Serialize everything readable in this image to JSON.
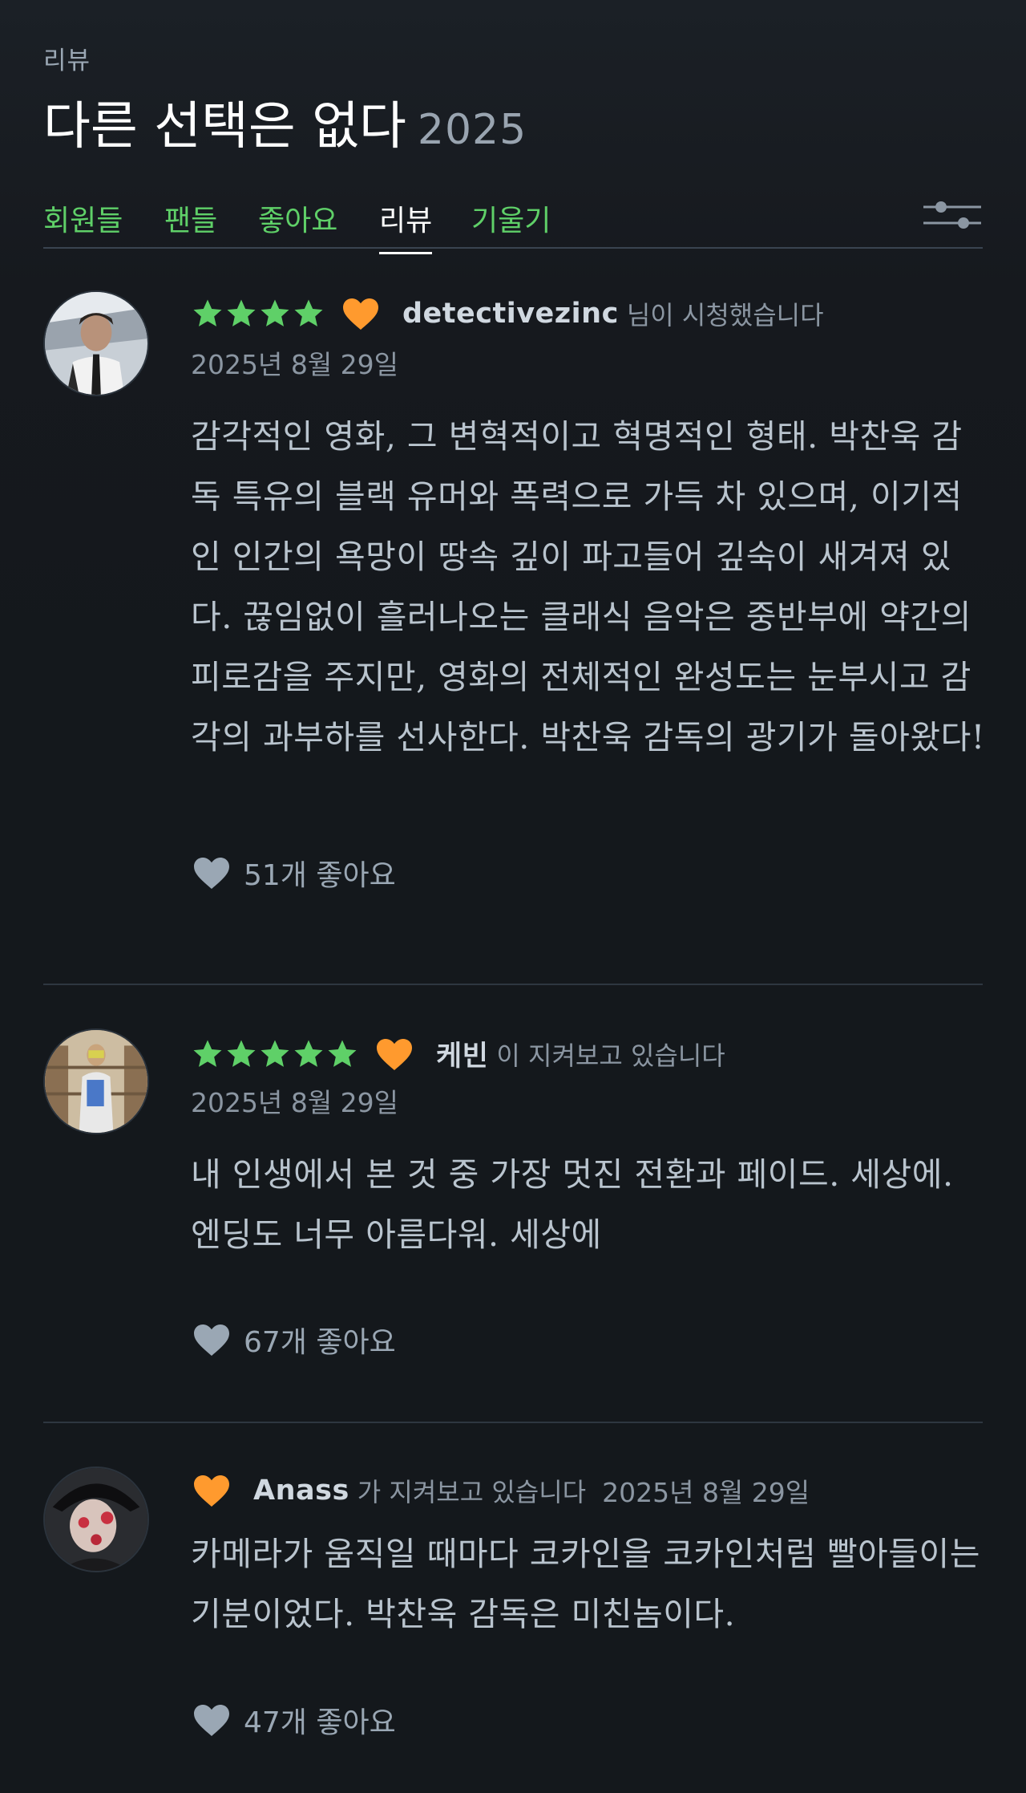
{
  "header": {
    "section_label": "리뷰",
    "film_title": "다른 선택은 없다",
    "film_year": "2025"
  },
  "tabs": [
    {
      "label": "회원들",
      "active": false
    },
    {
      "label": "팬들",
      "active": false
    },
    {
      "label": "좋아요",
      "active": false
    },
    {
      "label": "리뷰",
      "active": true
    },
    {
      "label": "기울기",
      "active": false
    }
  ],
  "icons": {
    "filter": "sliders-icon",
    "star": "star-icon",
    "liked": "heart-icon",
    "like_button": "heart-icon"
  },
  "colors": {
    "background": "#14181c",
    "tab_green": "#5fd068",
    "star_green": "#5fd068",
    "heart_orange": "#ff9a2e",
    "heart_grey": "#9aa7b4"
  },
  "reviews": [
    {
      "rating_stars": 4,
      "liked": true,
      "username": "detectivezinc",
      "action": "님이 시청했습니다",
      "date": "2025년 8월 29일",
      "text": "감각적인 영화, 그 변혁적이고 혁명적인 형태. 박찬욱 감독 특유의 블랙 유머와 폭력으로 가득 차 있으며, 이기적인 인간의 욕망이 땅속 깊이 파고들어 깊숙이 새겨져 있다. 끊임없이 흘러나오는 클래식 음악은 중반부에 약간의 피로감을 주지만, 영화의 전체적인 완성도는 눈부시고 감각의 과부하를 선사한다. 박찬욱 감독의 광기가 돌아왔다!",
      "likes": "51개 좋아요"
    },
    {
      "rating_stars": 5,
      "liked": true,
      "username": "케빈",
      "action": "이 지켜보고 있습니다",
      "date": "2025년 8월 29일",
      "text": "내 인생에서 본 것 중 가장 멋진 전환과 페이드. 세상에. 엔딩도 너무 아름다워. 세상에",
      "likes": "67개 좋아요"
    },
    {
      "rating_stars": 0,
      "liked": true,
      "username": "Anass",
      "action": "가 지켜보고 있습니다",
      "date": "2025년 8월 29일",
      "text": "카메라가 움직일 때마다 코카인을 코카인처럼 빨아들이는 기분이었다. 박찬욱 감독은 미친놈이다.",
      "likes": "47개 좋아요"
    }
  ]
}
